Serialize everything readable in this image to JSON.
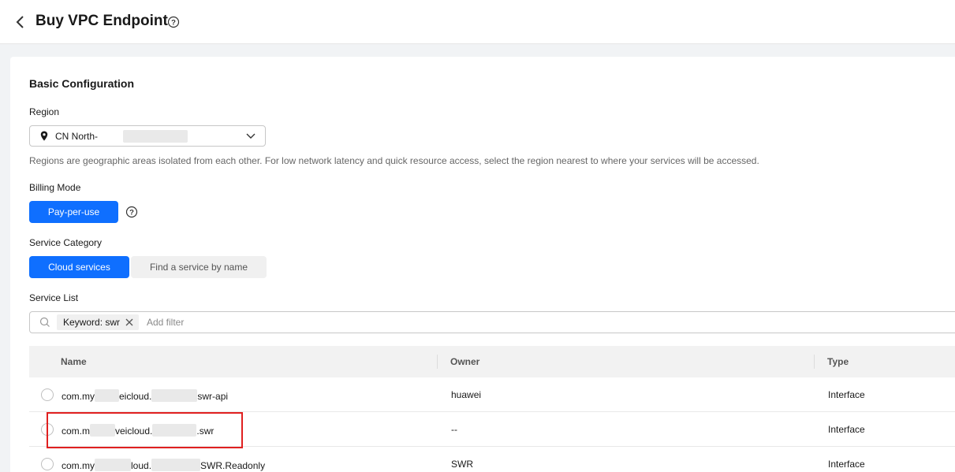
{
  "header": {
    "title": "Buy VPC Endpoint"
  },
  "basic": {
    "section_title": "Basic Configuration",
    "region_label": "Region",
    "region_value": "CN North-",
    "region_hint": "Regions are geographic areas isolated from each other. For low network latency and quick resource access, select the region nearest to where your services will be accessed.",
    "billing_label": "Billing Mode",
    "billing_value": "Pay-per-use",
    "category_label": "Service Category",
    "category_options": [
      "Cloud services",
      "Find a service by name"
    ],
    "category_selected": "Cloud services",
    "service_list_label": "Service List"
  },
  "filter": {
    "tag_label": "Keyword: swr",
    "placeholder": "Add filter"
  },
  "table": {
    "columns": [
      "Name",
      "Owner",
      "Type"
    ],
    "rows": [
      {
        "name_prefix": "com.my",
        "name_mid": "eicloud.",
        "name_suffix": "swr-api",
        "owner": "huawei",
        "type": "Interface"
      },
      {
        "name_prefix": "com.m",
        "name_mid": "veicloud.",
        "name_suffix": ".swr",
        "owner": "--",
        "type": "Interface"
      },
      {
        "name_prefix": "com.my",
        "name_mid": "loud.",
        "name_suffix": "SWR.Readonly",
        "owner": "SWR",
        "type": "Interface"
      }
    ]
  },
  "colors": {
    "accent": "#0f6fff",
    "highlight": "#e02020"
  },
  "icons": [
    "chevron-left-icon",
    "help-icon",
    "location-pin-icon",
    "chevron-down-icon",
    "search-icon",
    "close-icon"
  ]
}
